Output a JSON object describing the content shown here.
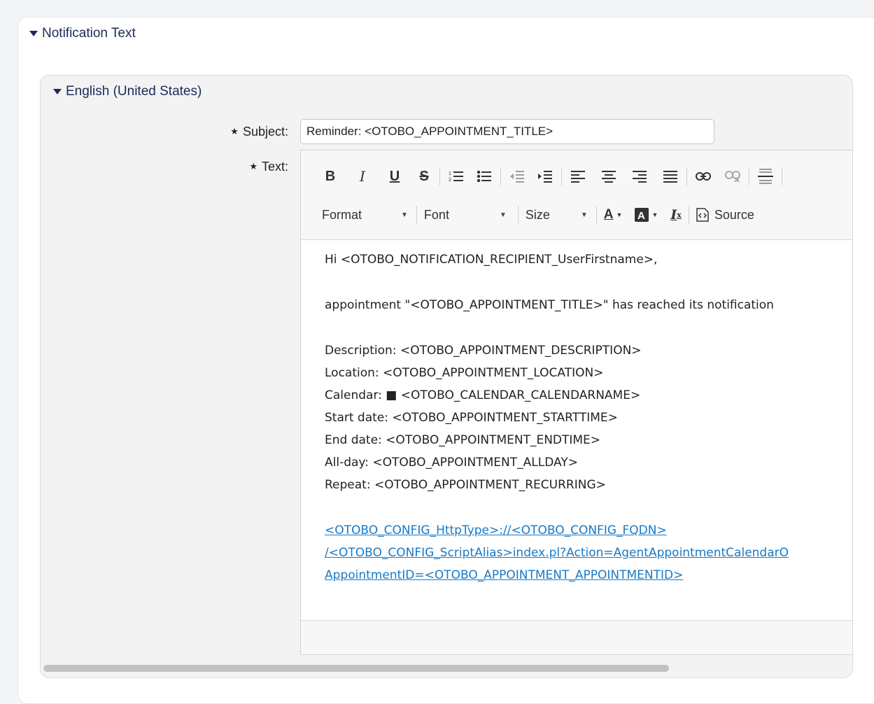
{
  "section": {
    "title": "Notification Text"
  },
  "language": {
    "title": "English (United States)"
  },
  "form": {
    "subject_label": "Subject:",
    "subject_value": "Reminder: <OTOBO_APPOINTMENT_TITLE>",
    "text_label": "Text:",
    "required_marker": "★"
  },
  "toolbar": {
    "format_label": "Format",
    "font_label": "Font",
    "size_label": "Size",
    "source_label": "Source"
  },
  "editor_content": {
    "greeting": "Hi <OTOBO_NOTIFICATION_RECIPIENT_UserFirstname>,",
    "intro": "appointment \"<OTOBO_APPOINTMENT_TITLE>\" has reached its notification",
    "lines": [
      "Description: <OTOBO_APPOINTMENT_DESCRIPTION>",
      "Location: <OTOBO_APPOINTMENT_LOCATION>",
      "Calendar: ■ <OTOBO_CALENDAR_CALENDARNAME>",
      "Start date: <OTOBO_APPOINTMENT_STARTTIME>",
      "End date: <OTOBO_APPOINTMENT_ENDTIME>",
      "All-day: <OTOBO_APPOINTMENT_ALLDAY>",
      "Repeat: <OTOBO_APPOINTMENT_RECURRING>"
    ],
    "link_lines": [
      "<OTOBO_CONFIG_HttpType>://<OTOBO_CONFIG_FQDN>",
      "/<OTOBO_CONFIG_ScriptAlias>index.pl?Action=AgentAppointmentCalendarO",
      "AppointmentID=<OTOBO_APPOINTMENT_APPOINTMENTID>"
    ]
  }
}
